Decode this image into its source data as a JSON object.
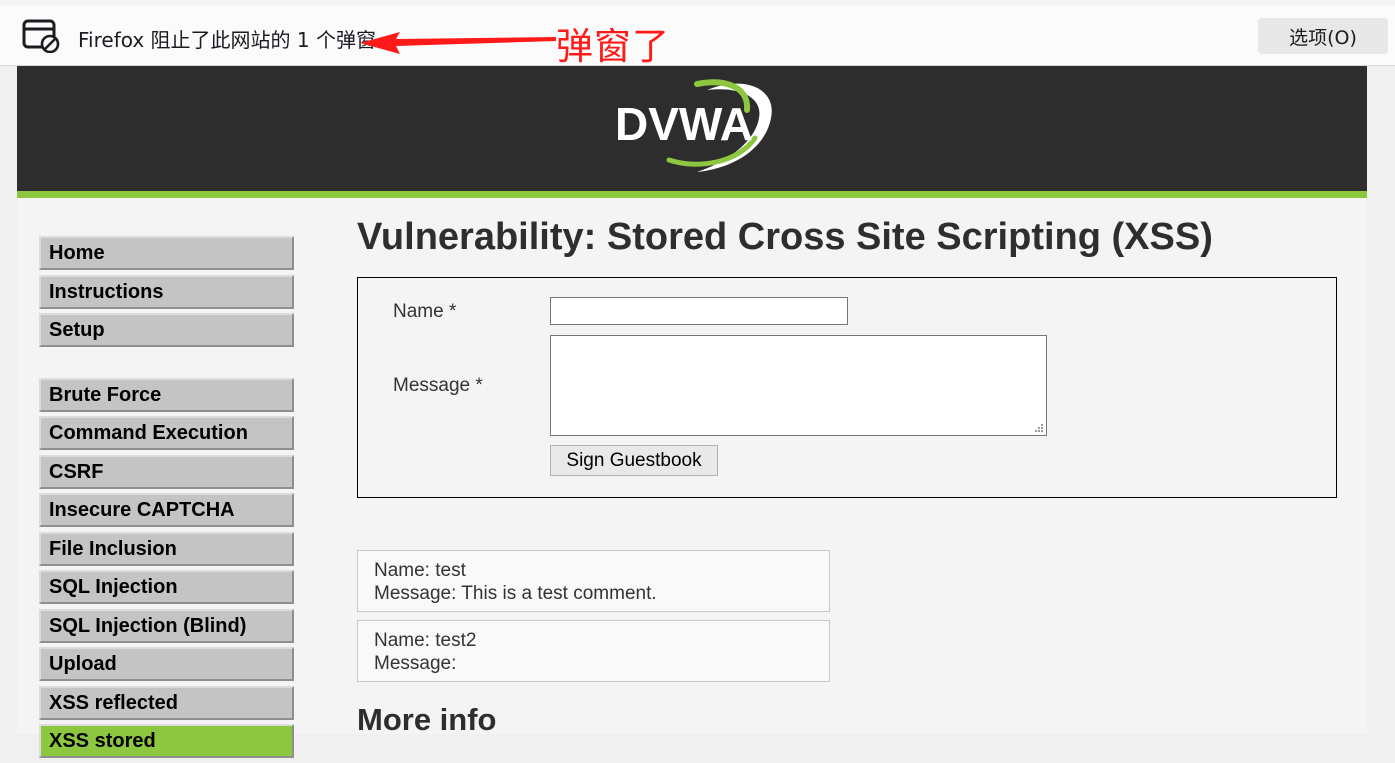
{
  "notification": {
    "message": "Firefox 阻止了此网站的 1 个弹窗",
    "options_label": "选项(O)",
    "annotation": "弹窗了"
  },
  "site": {
    "logo_text": "DVWA",
    "accent_color": "#8dc63f",
    "header_color": "#2d2d2d"
  },
  "menu": {
    "group1": [
      "Home",
      "Instructions",
      "Setup"
    ],
    "group2": [
      "Brute Force",
      "Command Execution",
      "CSRF",
      "Insecure CAPTCHA",
      "File Inclusion",
      "SQL Injection",
      "SQL Injection (Blind)",
      "Upload",
      "XSS reflected",
      "XSS stored"
    ],
    "active": "XSS stored"
  },
  "page": {
    "title": "Vulnerability: Stored Cross Site Scripting (XSS)",
    "form": {
      "name_label": "Name *",
      "name_value": "",
      "message_label": "Message *",
      "message_value": "",
      "submit_label": "Sign Guestbook"
    },
    "entries": [
      {
        "name": "Name: test",
        "message": "Message: This is a test comment."
      },
      {
        "name": "Name: test2",
        "message": "Message:"
      }
    ],
    "more_info_heading": "More info"
  }
}
